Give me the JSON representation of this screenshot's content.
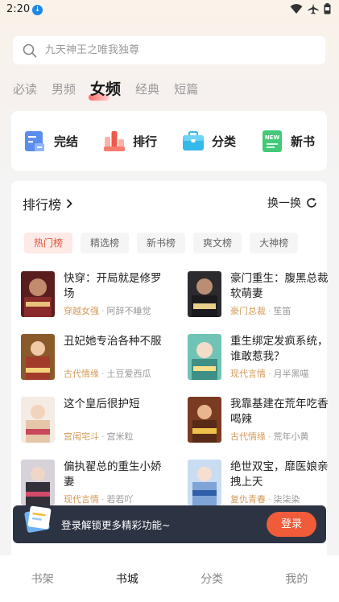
{
  "status_bar": {
    "time": "2:20"
  },
  "search": {
    "placeholder": "九天神王之唯我独尊"
  },
  "tabs": [
    "必读",
    "男频",
    "女频",
    "经典",
    "短篇"
  ],
  "quick_links": [
    {
      "label": "完结",
      "icon": "complete-icon"
    },
    {
      "label": "排行",
      "icon": "ranking-icon"
    },
    {
      "label": "分类",
      "icon": "category-icon"
    },
    {
      "label": "新书",
      "icon": "new-book-icon"
    }
  ],
  "ranking": {
    "title": "排行榜",
    "refresh": "换一换",
    "chips": [
      "热门榜",
      "精选榜",
      "新书榜",
      "爽文榜",
      "大神榜"
    ],
    "books": [
      {
        "title": "快穿：开局就是修罗场",
        "tag": "穿越女强",
        "author": "阿辞不睡觉"
      },
      {
        "title": "豪门重生：腹黑总裁软萌妻",
        "tag": "豪门总裁",
        "author": "笙笛"
      },
      {
        "title": "丑妃她专治各种不服",
        "tag": "古代情缘",
        "author": "土豆爱西瓜"
      },
      {
        "title": "重生绑定发疯系统，谁敢惹我？",
        "tag": "现代言情",
        "author": "月半黑喵"
      },
      {
        "title": "这个皇后很护短",
        "tag": "宫闱宅斗",
        "author": "宫米粒"
      },
      {
        "title": "我靠基建在荒年吃香喝辣",
        "tag": "古代情缘",
        "author": "荒年小黄"
      },
      {
        "title": "偏执翟总的重生小娇妻",
        "tag": "现代言情",
        "author": "若若吖"
      },
      {
        "title": "绝世双宝，靡医娘亲拽上天",
        "tag": "复仇青春",
        "author": "柒柒染"
      }
    ]
  },
  "login_banner": {
    "hint": "登录解锁更多精彩功能~",
    "button": "登录"
  },
  "bottom_nav": [
    "书架",
    "书城",
    "分类",
    "我的"
  ],
  "colors": {
    "accent": "#f05b3a",
    "tag": "#d39a5a",
    "chip_active_bg": "#fde9e6"
  }
}
